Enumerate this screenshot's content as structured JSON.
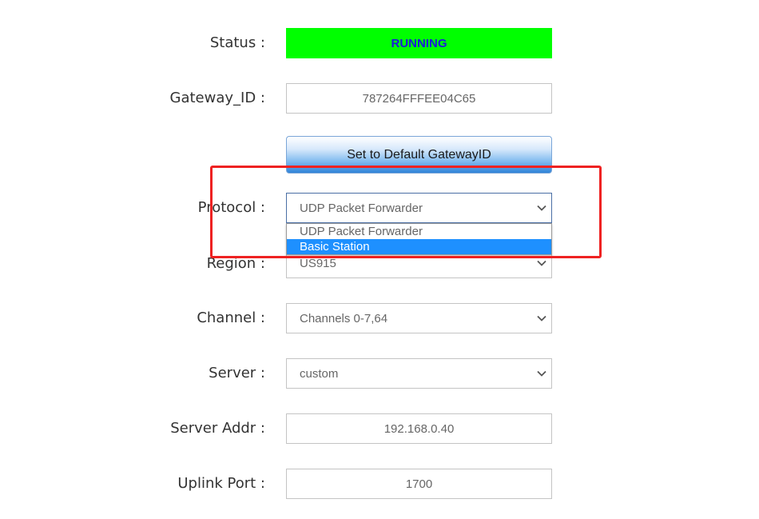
{
  "status": {
    "label": "Status :",
    "value": "RUNNING",
    "color": "#00ff00"
  },
  "gateway_id": {
    "label": "Gateway_ID :",
    "value": "787264FFFEE04C65"
  },
  "default_button": {
    "label": "Set to Default GatewayID"
  },
  "protocol": {
    "label": "Protocol :",
    "value": "UDP Packet Forwarder",
    "options": [
      "UDP Packet Forwarder",
      "Basic Station"
    ],
    "highlighted_option": "Basic Station"
  },
  "region": {
    "label": "Region :",
    "value": "US915"
  },
  "channel": {
    "label": "Channel :",
    "value": "Channels 0-7,64"
  },
  "server": {
    "label": "Server :",
    "value": "custom"
  },
  "server_addr": {
    "label": "Server Addr :",
    "value": "192.168.0.40"
  },
  "uplink_port": {
    "label": "Uplink Port :",
    "value": "1700"
  },
  "colors": {
    "highlight_box": "#ee2222",
    "option_highlight": "#1e90ff",
    "status_text": "#1a1adc"
  },
  "icons": {
    "select_arrow": "chevron-down-icon"
  }
}
